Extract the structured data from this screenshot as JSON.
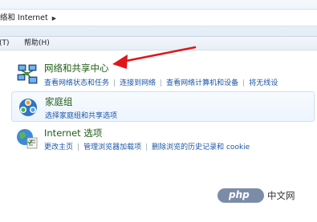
{
  "address": {
    "breadcrumb": "络和 Internet",
    "arrow_icon": "chevron-right-icon"
  },
  "menu": {
    "partial": "T)",
    "help": "帮助(H)"
  },
  "sections": [
    {
      "title": "网络和共享中心",
      "icon": "network-icon",
      "links": [
        "查看网络状态和任务",
        "连接到网络",
        "查看网络计算机和设备",
        "将无线设"
      ]
    },
    {
      "title": "家庭组",
      "icon": "homegroup-icon",
      "links": [
        "选择家庭组和共享选项"
      ]
    },
    {
      "title": "Internet 选项",
      "icon": "internet-options-icon",
      "links": [
        "更改主页",
        "管理浏览器加载项",
        "删除浏览的历史记录和 cookie"
      ]
    }
  ],
  "watermark": {
    "badge": "php",
    "text": "中文网"
  },
  "colors": {
    "title_green": "#1e5b17",
    "link_blue": "#1a56a8",
    "arrow_red": "#e0161b"
  }
}
